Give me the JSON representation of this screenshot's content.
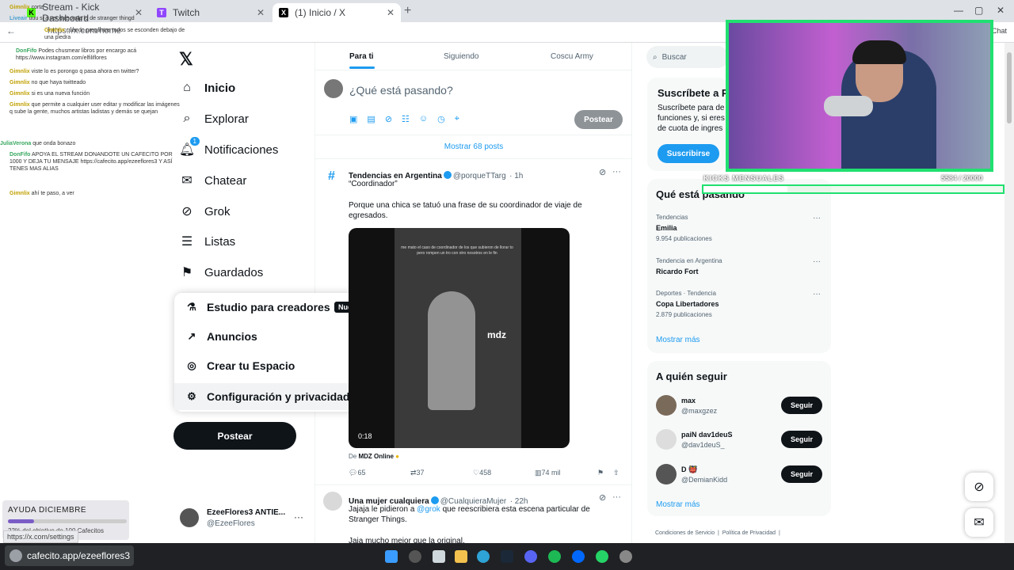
{
  "browser": {
    "tabs": [
      {
        "label": "Stream - Kick Dashboard",
        "active": false
      },
      {
        "label": "Twitch",
        "active": false
      },
      {
        "label": "(1) Inicio / X",
        "active": true
      }
    ],
    "address": "https://x.com/home"
  },
  "nav": {
    "items": [
      {
        "label": "Inicio",
        "icon": "home-icon",
        "bold": true
      },
      {
        "label": "Explorar",
        "icon": "search-icon"
      },
      {
        "label": "Notificaciones",
        "icon": "bell-icon",
        "badge": "1"
      },
      {
        "label": "Chatear",
        "icon": "mail-icon"
      },
      {
        "label": "Grok",
        "icon": "grok-icon"
      },
      {
        "label": "Listas",
        "icon": "list-icon"
      },
      {
        "label": "Guardados",
        "icon": "bookmark-icon"
      }
    ],
    "popup": [
      {
        "label": "Estudio para creadores",
        "icon": "flask-icon",
        "tag": "Nuevo"
      },
      {
        "label": "Anuncios",
        "icon": "ads-icon"
      },
      {
        "label": "Crear tu Espacio",
        "icon": "spaces-icon"
      },
      {
        "label": "Configuración y privacidad",
        "icon": "gear-icon"
      }
    ],
    "post_button": "Postear",
    "account": {
      "name": "EzeeFlores3 ANTIE...",
      "handle": "@EzeeFlores"
    }
  },
  "chat": [
    {
      "user": "Gimnlix",
      "text": "corta"
    },
    {
      "user": "Liveair",
      "text": "uuu si a ver que onda lo de stranger thingd"
    },
    {
      "user": "Gimnlix",
      "text": "cuando preguntas todos se esconden debajo de una piedra"
    },
    {
      "user": "DonFifo",
      "text": "Podes chusmear libros por encargo acá https://www.instagram.com/elfiliflores"
    },
    {
      "user": "Gimnlix",
      "text": "viste lo es porongo q pasa ahora en twitter?"
    },
    {
      "user": "Gimnlix",
      "text": "no que haya twitteado"
    },
    {
      "user": "Gimnlix",
      "text": "si es una nueva función"
    },
    {
      "user": "Gimnlix",
      "text": "que permite a cualquier user editar y modificar las imágenes q sube la gente, muchos artistas ladistas y demás se quejan"
    },
    {
      "user": "JuliaVerona",
      "text": "que onda bonazo"
    },
    {
      "user": "DonFifo",
      "text": "APOYA EL STREAM DONANDOTE UN CAFECITO POR 1000 Y DEJA TU MENSAJE https://cafecito.app/ezeeflores3 Y ASÍ TENES MAS ALIAS"
    },
    {
      "user": "Gimnlix",
      "text": "ahí te paso, a ver"
    }
  ],
  "feed": {
    "tabs": [
      "Para ti",
      "Siguiendo",
      "Coscu Army"
    ],
    "compose_placeholder": "¿Qué está pasando?",
    "compose_button": "Postear",
    "show_more": "Mostrar 68 posts",
    "tweet1": {
      "author": "Tendencias en Argentina",
      "handle": "@porqueTTarg",
      "time": "· 1h",
      "quote": "“Coordinador”",
      "text": "Porque una chica se tatuó una frase de su coordinador de viaje de egresados.",
      "video_caption": "me mato el caso de coordinador de los que subieron de llorar to pero rompen un tro con otro nosotros en le fin",
      "video_duration": "0:18",
      "video_watermark": "mdz",
      "source_prefix": "De",
      "source": "MDZ Online",
      "replies": "65",
      "reposts": "37",
      "likes": "458",
      "views": "74 mil"
    },
    "tweet2": {
      "author": "Una mujer cualquiera",
      "handle": "@CualquieraMujer",
      "time": "· 22h",
      "text1": "Jajaja le pidieron a",
      "mention": "@grok",
      "text2": "que reescribiera esta escena particular de Stranger Things.",
      "text3": "Jaja mucho mejor que la original."
    }
  },
  "sidebar": {
    "search_placeholder": "Buscar",
    "premium": {
      "title": "Suscríbete a P",
      "text": "Suscríbete para de funciones y, si eres de cuota de ingres",
      "button": "Suscribirse"
    },
    "trends_title": "Qué está pasando",
    "trends": [
      {
        "context": "Tendencias",
        "name": "Emilia",
        "count": "9.954 publicaciones"
      },
      {
        "context": "Tendencia en Argentina",
        "name": "Ricardo Fort",
        "count": ""
      },
      {
        "context": "Deportes · Tendencia",
        "name": "Copa Libertadores",
        "count": "2.879 publicaciones"
      }
    ],
    "show_more": "Mostrar más",
    "who_title": "A quién seguir",
    "who": [
      {
        "name": "max",
        "handle": "@maxgzez"
      },
      {
        "name": "paiN dav1deuS",
        "handle": "@dav1deuS_"
      },
      {
        "name": "D 👹",
        "handle": "@DemianKidd"
      }
    ],
    "follow_label": "Seguir",
    "who_more": "Mostrar más",
    "footer": [
      "Condiciones de Servicio",
      "|",
      "Política de Privacidad",
      "|"
    ]
  },
  "overlay": {
    "kicks_label": "KICKS MENSUALES",
    "kicks_value": "5584 / 20000",
    "kicks_fraction": 0.28,
    "ayuda_title": "AYUDA DICIEMBRE",
    "ayuda_sub": "22% del objetivo de 100 Cafecitos",
    "ayuda_fraction": 0.22,
    "status_url": "https://x.com/settings"
  },
  "taskbar": {
    "active_app": "cafecito.app/ezeeflores3"
  },
  "colors": {
    "accent": "#1d9bf0",
    "cam_border": "#20e070"
  }
}
